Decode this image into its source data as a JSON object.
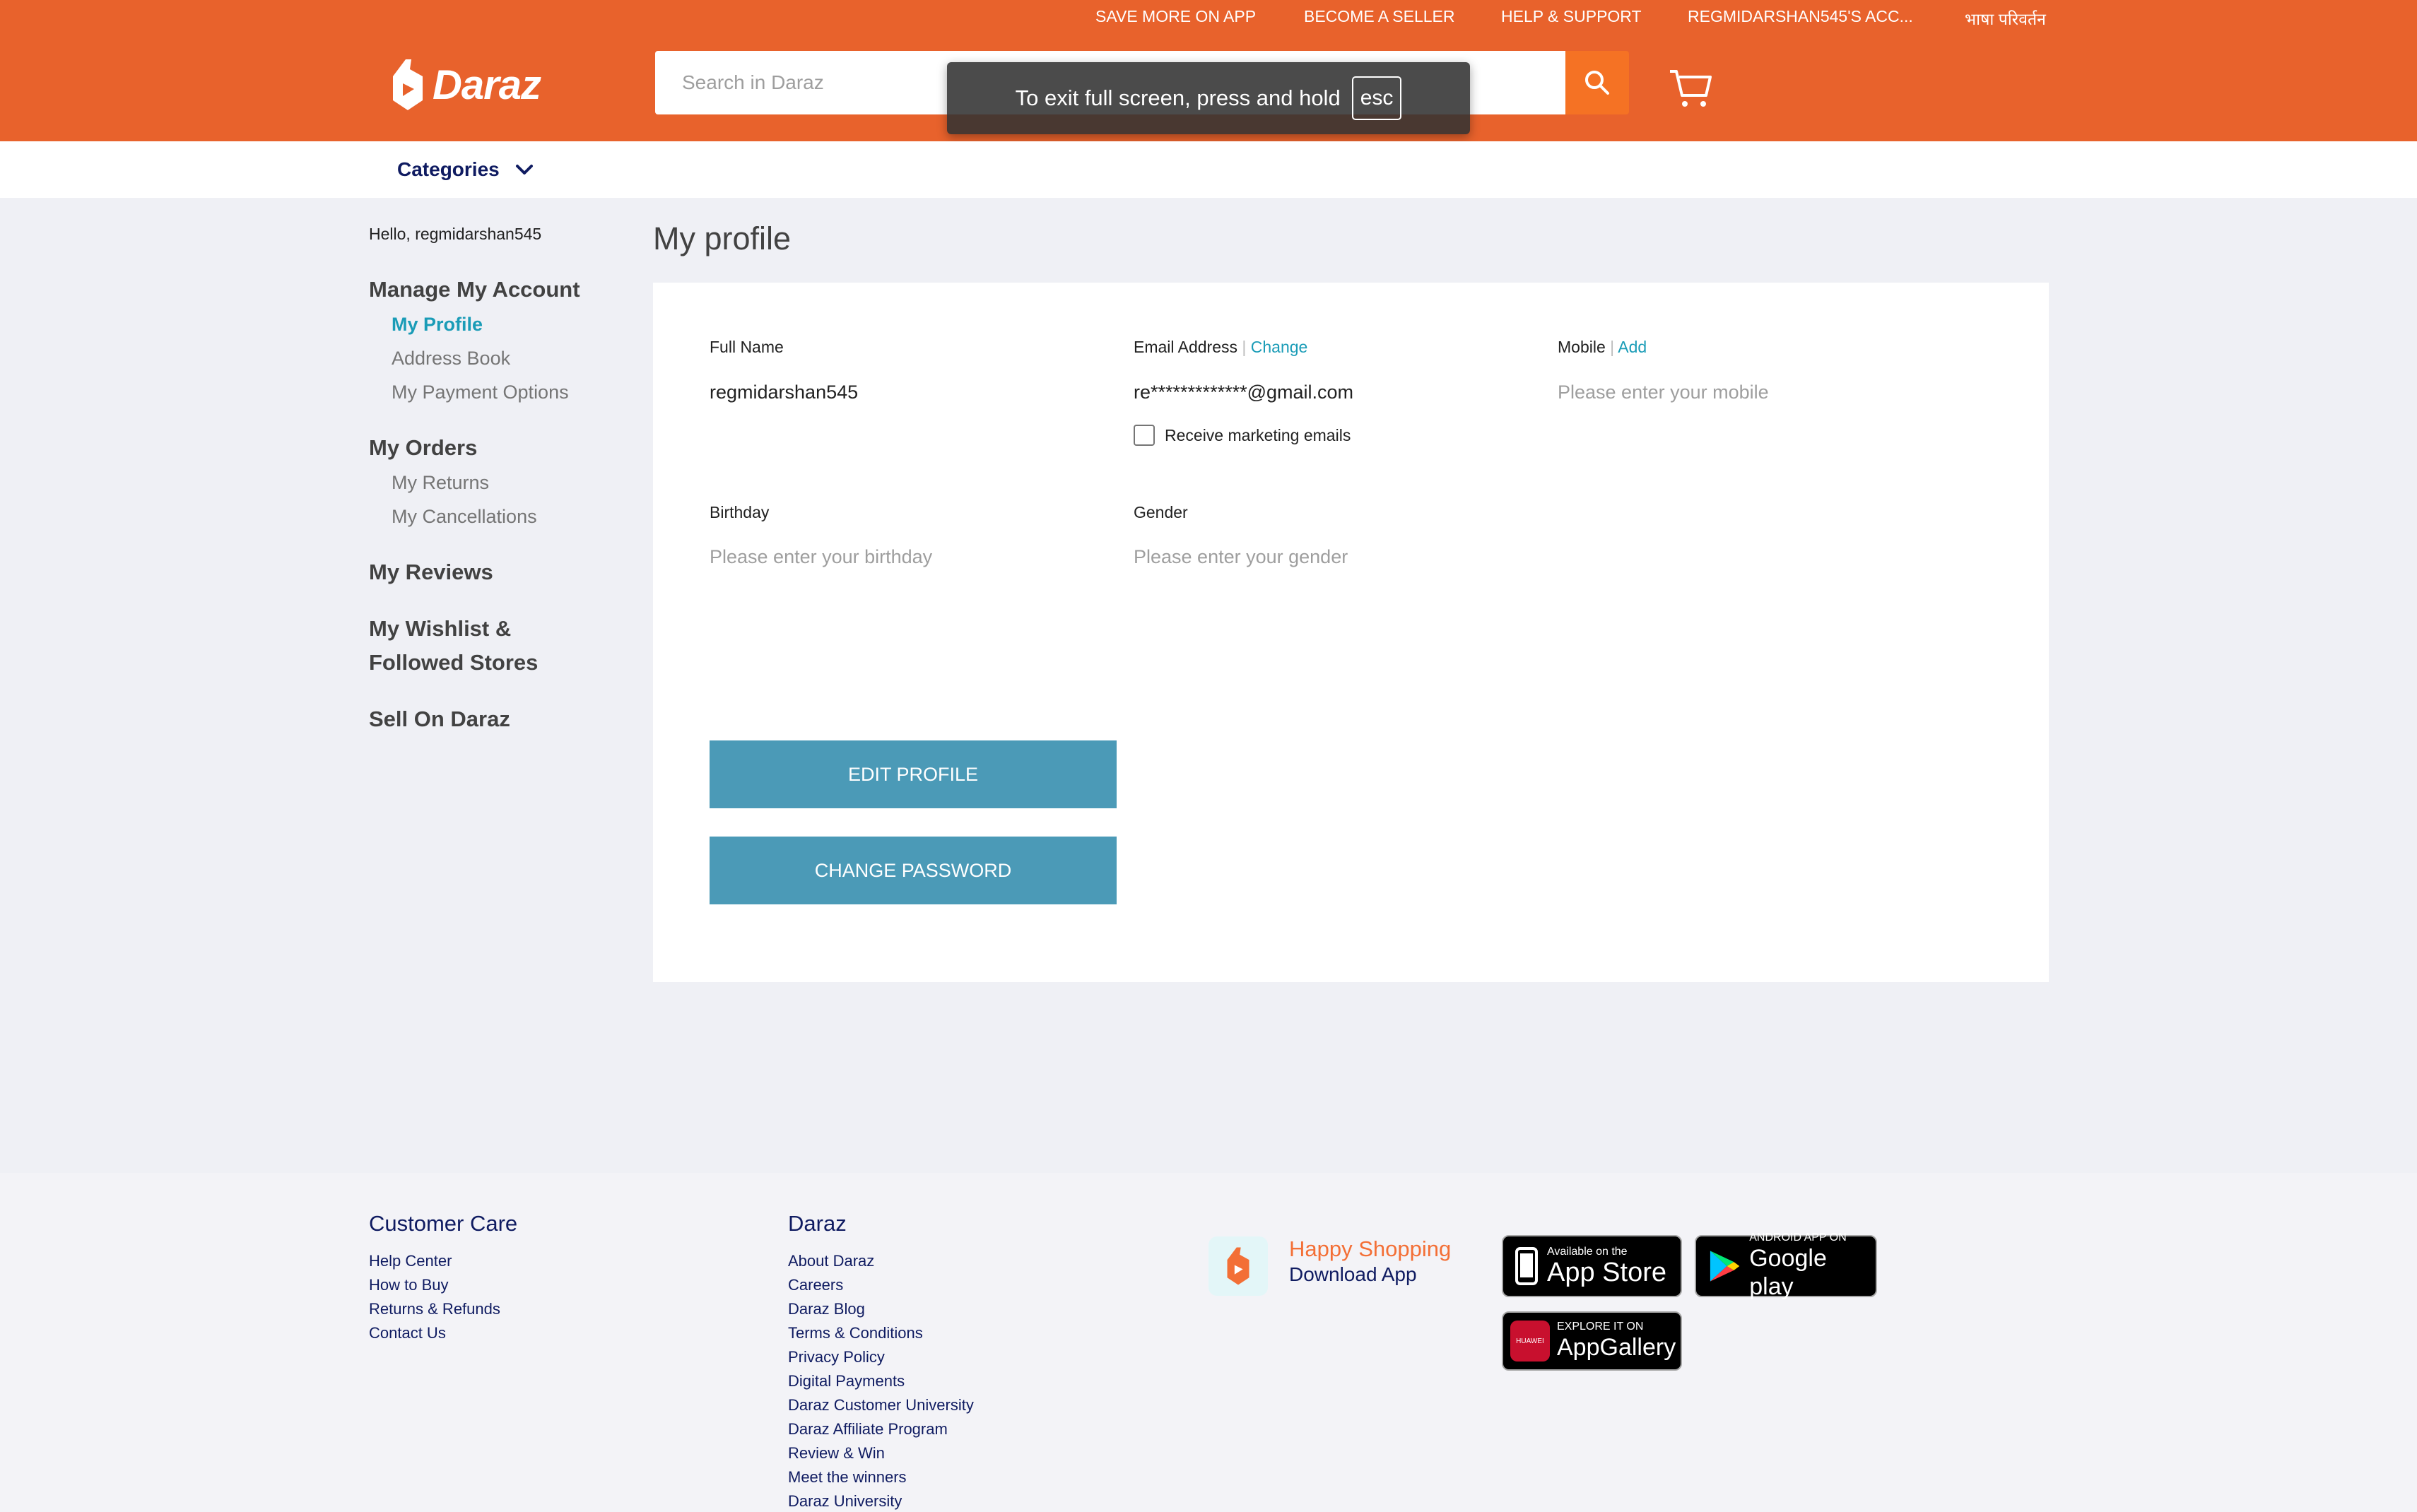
{
  "topbar": {
    "items": [
      "SAVE MORE ON APP",
      "BECOME A SELLER",
      "HELP & SUPPORT",
      "REGMIDARSHAN545'S ACC...",
      "भाषा परिवर्तन"
    ]
  },
  "brand": {
    "name": "Daraz",
    "color": "#e8622c"
  },
  "search": {
    "placeholder": "Search in Daraz"
  },
  "fullscreen_toast": {
    "text": "To exit full screen, press and hold",
    "key": "esc"
  },
  "categories": {
    "label": "Categories"
  },
  "sidebar": {
    "hello": "Hello, regmidarshan545",
    "manage_account": "Manage My Account",
    "my_profile": "My Profile",
    "address_book": "Address Book",
    "payment_options": "My Payment Options",
    "my_orders": "My Orders",
    "my_returns": "My Returns",
    "my_cancellations": "My Cancellations",
    "my_reviews": "My Reviews",
    "wishlist_line1": "My Wishlist &",
    "wishlist_line2": "Followed Stores",
    "sell_on": "Sell On Daraz"
  },
  "profile": {
    "title": "My profile",
    "full_name_label": "Full Name",
    "full_name_value": "regmidarshan545",
    "email_label": "Email Address",
    "email_change": "Change",
    "email_value": "re*************@gmail.com",
    "marketing_label": "Receive marketing emails",
    "mobile_label": "Mobile",
    "mobile_add": "Add",
    "mobile_placeholder": "Please enter your mobile",
    "birthday_label": "Birthday",
    "birthday_placeholder": "Please enter your birthday",
    "gender_label": "Gender",
    "gender_placeholder": "Please enter your gender",
    "edit_button": "EDIT PROFILE",
    "change_password_button": "CHANGE PASSWORD",
    "separator": "|"
  },
  "footer": {
    "customer_care": {
      "title": "Customer Care",
      "links": [
        "Help Center",
        "How to Buy",
        "Returns & Refunds",
        "Contact Us"
      ]
    },
    "daraz": {
      "title": "Daraz",
      "links": [
        "About Daraz",
        "Careers",
        "Daraz Blog",
        "Terms & Conditions",
        "Privacy Policy",
        "Digital Payments",
        "Daraz Customer University",
        "Daraz Affiliate Program",
        "Review & Win",
        "Meet the winners",
        "Daraz University"
      ]
    },
    "app": {
      "happy": "Happy Shopping",
      "download": "Download App",
      "appstore_small": "Available on the",
      "appstore_big": "App Store",
      "googleplay_small": "ANDROID APP ON",
      "googleplay_big": "Google play",
      "appgallery_small": "EXPLORE IT ON",
      "appgallery_big": "AppGallery",
      "huawei": "HUAWEI"
    }
  }
}
